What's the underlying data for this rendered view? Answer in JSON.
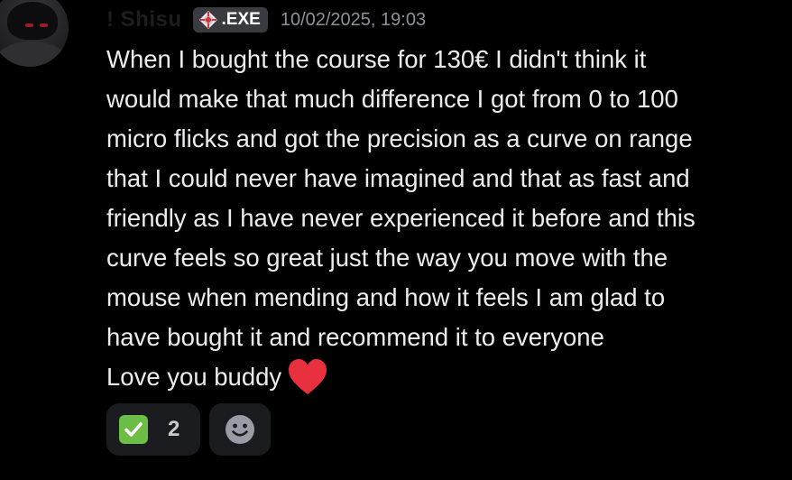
{
  "message": {
    "username": "! Shisu",
    "tag": {
      "icon": "diamond-badge-icon",
      "label": ".EXE"
    },
    "timestamp": "10/02/2025, 19:03",
    "lines": [
      "When I bought the course for 130€ I didn't think it",
      "would make that much difference I got from 0 to 100",
      "micro flicks and got the precision as a curve on range",
      "that I could never have imagined and that as fast and",
      "friendly as I have never experienced it before and this",
      "curve feels so great just the way you move with the",
      "mouse when mending and how it feels I am glad to",
      "have bought it and recommend it to everyone",
      "Love you buddy"
    ],
    "trailing_emoji": "red-heart-icon"
  },
  "reactions": [
    {
      "icon": "white-check-mark-icon",
      "count": "2"
    },
    {
      "icon": "add-reaction-smile-icon"
    }
  ],
  "colors": {
    "background": "#000000",
    "text": "#ececee",
    "timestamp": "#8e9099",
    "tag_background": "#3a3b40",
    "reaction_background": "#1a1b1e",
    "check_green": "#6bbd45",
    "heart_red": "#e8303f"
  }
}
